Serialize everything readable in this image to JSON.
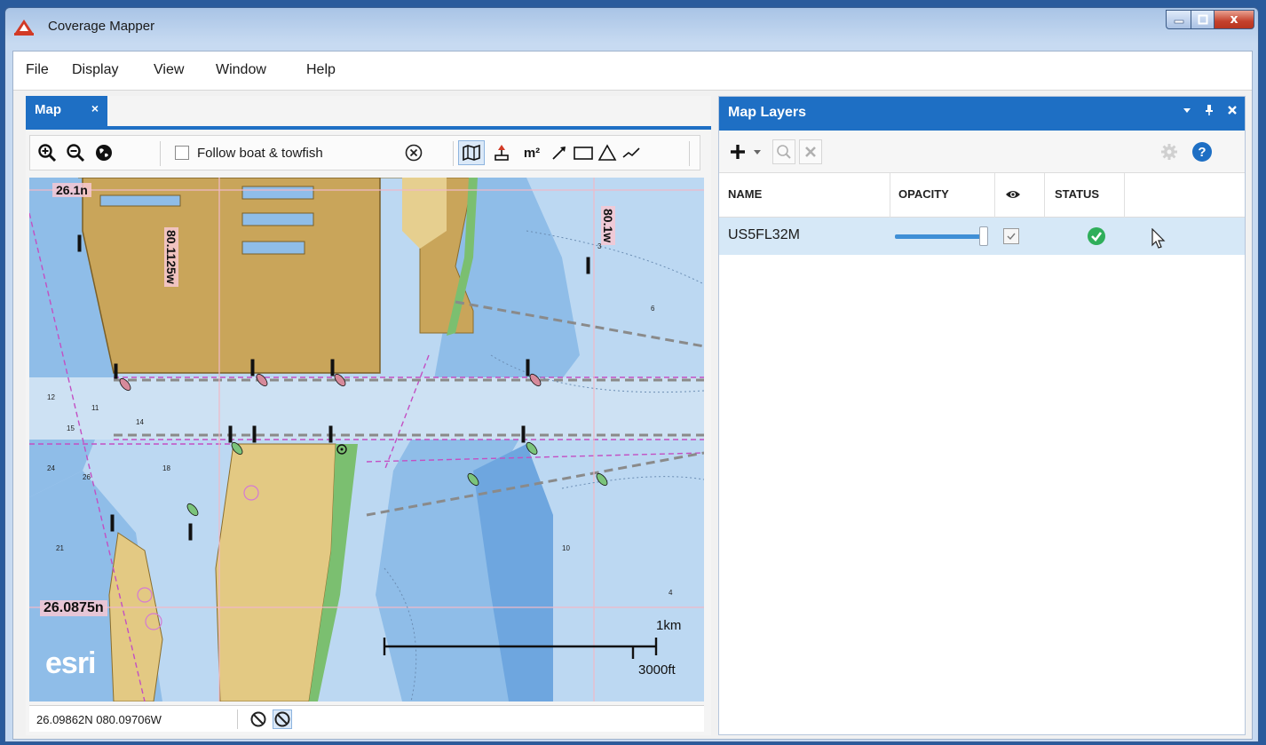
{
  "window": {
    "title": "Coverage Mapper",
    "close_glyph": "x"
  },
  "menu": [
    "File",
    "Display",
    "View",
    "Window",
    "Help"
  ],
  "map_tab": {
    "label": "Map",
    "close": "×"
  },
  "map_toolbar": {
    "follow_label": "Follow boat & towfish",
    "area_unit": "m²"
  },
  "map": {
    "lat_labels": [
      "26.1n",
      "26.0875n"
    ],
    "lon_labels": [
      "80.1125w",
      "80.1w"
    ],
    "scale_km": "1km",
    "scale_ft": "3000ft",
    "watermark": "esri",
    "soundings": [
      "12",
      "15",
      "11",
      "14",
      "21",
      "3",
      "6",
      "24",
      "26",
      "18",
      "10",
      "4"
    ]
  },
  "status": {
    "coords": "26.09862N 080.09706W"
  },
  "layers_panel": {
    "title": "Map Layers",
    "columns": {
      "name": "NAME",
      "opacity": "OPACITY",
      "status": "STATUS"
    },
    "rows": [
      {
        "name": "US5FL32M",
        "opacity": 0.95,
        "visible": true,
        "status": "ok"
      }
    ]
  },
  "colors": {
    "accent": "#1e6fc4",
    "land": "#c9a55a",
    "shallow": "#82b6e6",
    "deep": "#b9d7f2",
    "ok": "#2fae5a"
  }
}
